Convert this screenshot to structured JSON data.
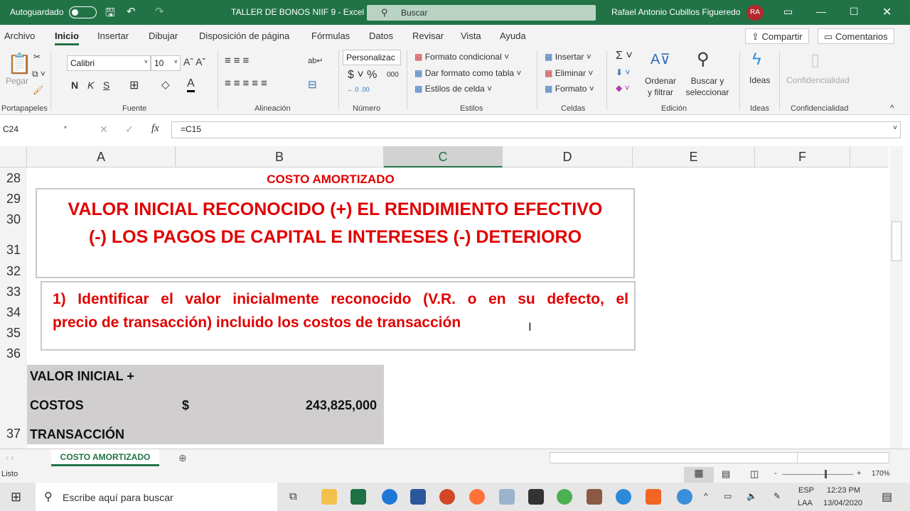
{
  "titlebar": {
    "autosave": "Autoguardado",
    "doc_title": "TALLER DE BONOS NIIF 9  -  Excel",
    "search": "Buscar",
    "user": "Rafael Antonio Cubillos Figueredo",
    "initials": "RA"
  },
  "menu": {
    "tabs": [
      "Archivo",
      "Inicio",
      "Insertar",
      "Dibujar",
      "Disposición de página",
      "Fórmulas",
      "Datos",
      "Revisar",
      "Vista",
      "Ayuda"
    ],
    "active": "Inicio",
    "share": "Compartir",
    "comments": "Comentarios"
  },
  "ribbon": {
    "paste": "Pegar",
    "font": "Calibri",
    "size": "10",
    "bold": "N",
    "italic": "K",
    "underline": "S",
    "number_format": "Personalizac",
    "conditional": "Formato condicional",
    "as_table": "Dar formato como tabla",
    "cell_styles": "Estilos de celda",
    "insert": "Insertar",
    "delete": "Eliminar",
    "format": "Formato",
    "sort": "Ordenar y filtrar",
    "find": "Buscar y seleccionar",
    "ideas": "Ideas",
    "confidential": "Confidencialidad",
    "groups": [
      "Portapapeles",
      "Fuente",
      "Alineación",
      "Número",
      "Estilos",
      "Celdas",
      "Edición",
      "Ideas",
      "Confidencialidad"
    ]
  },
  "formula": {
    "name_box": "C24",
    "formula": "=C15"
  },
  "columns": [
    "A",
    "B",
    "C",
    "D",
    "E",
    "F"
  ],
  "selected_column": "C",
  "rows": [
    "28",
    "29",
    "30",
    "31",
    "32",
    "33",
    "34",
    "35",
    "36",
    "37"
  ],
  "sheet": {
    "heading": "COSTO AMORTIZADO",
    "box1_line1": "VALOR INICIAL RECONOCIDO (+) EL RENDIMIENTO EFECTIVO",
    "box1_line2": "(-) LOS PAGOS DE CAPITAL E INTERESES (-) DETERIORO",
    "box2_line1": "1) Identificar el valor inicialmente reconocido (V.R. o en su defecto, el",
    "box2_line2": "precio de transacción) incluido los costos de transacción",
    "label1": "VALOR INICIAL +",
    "label2": "COSTOS",
    "label3": "TRANSACCIÓN",
    "currency": "$",
    "amount": "243,825,000",
    "text_color": "#e00000"
  },
  "sheet_tabs": [
    "COSTO AMORTIZADO"
  ],
  "status": {
    "ready": "Listo",
    "zoom": "170%"
  },
  "taskbar": {
    "search": "Escribe aquí para buscar",
    "lang1": "ESP",
    "lang2": "LAA",
    "time": "12:23 PM",
    "date": "13/04/2020"
  }
}
